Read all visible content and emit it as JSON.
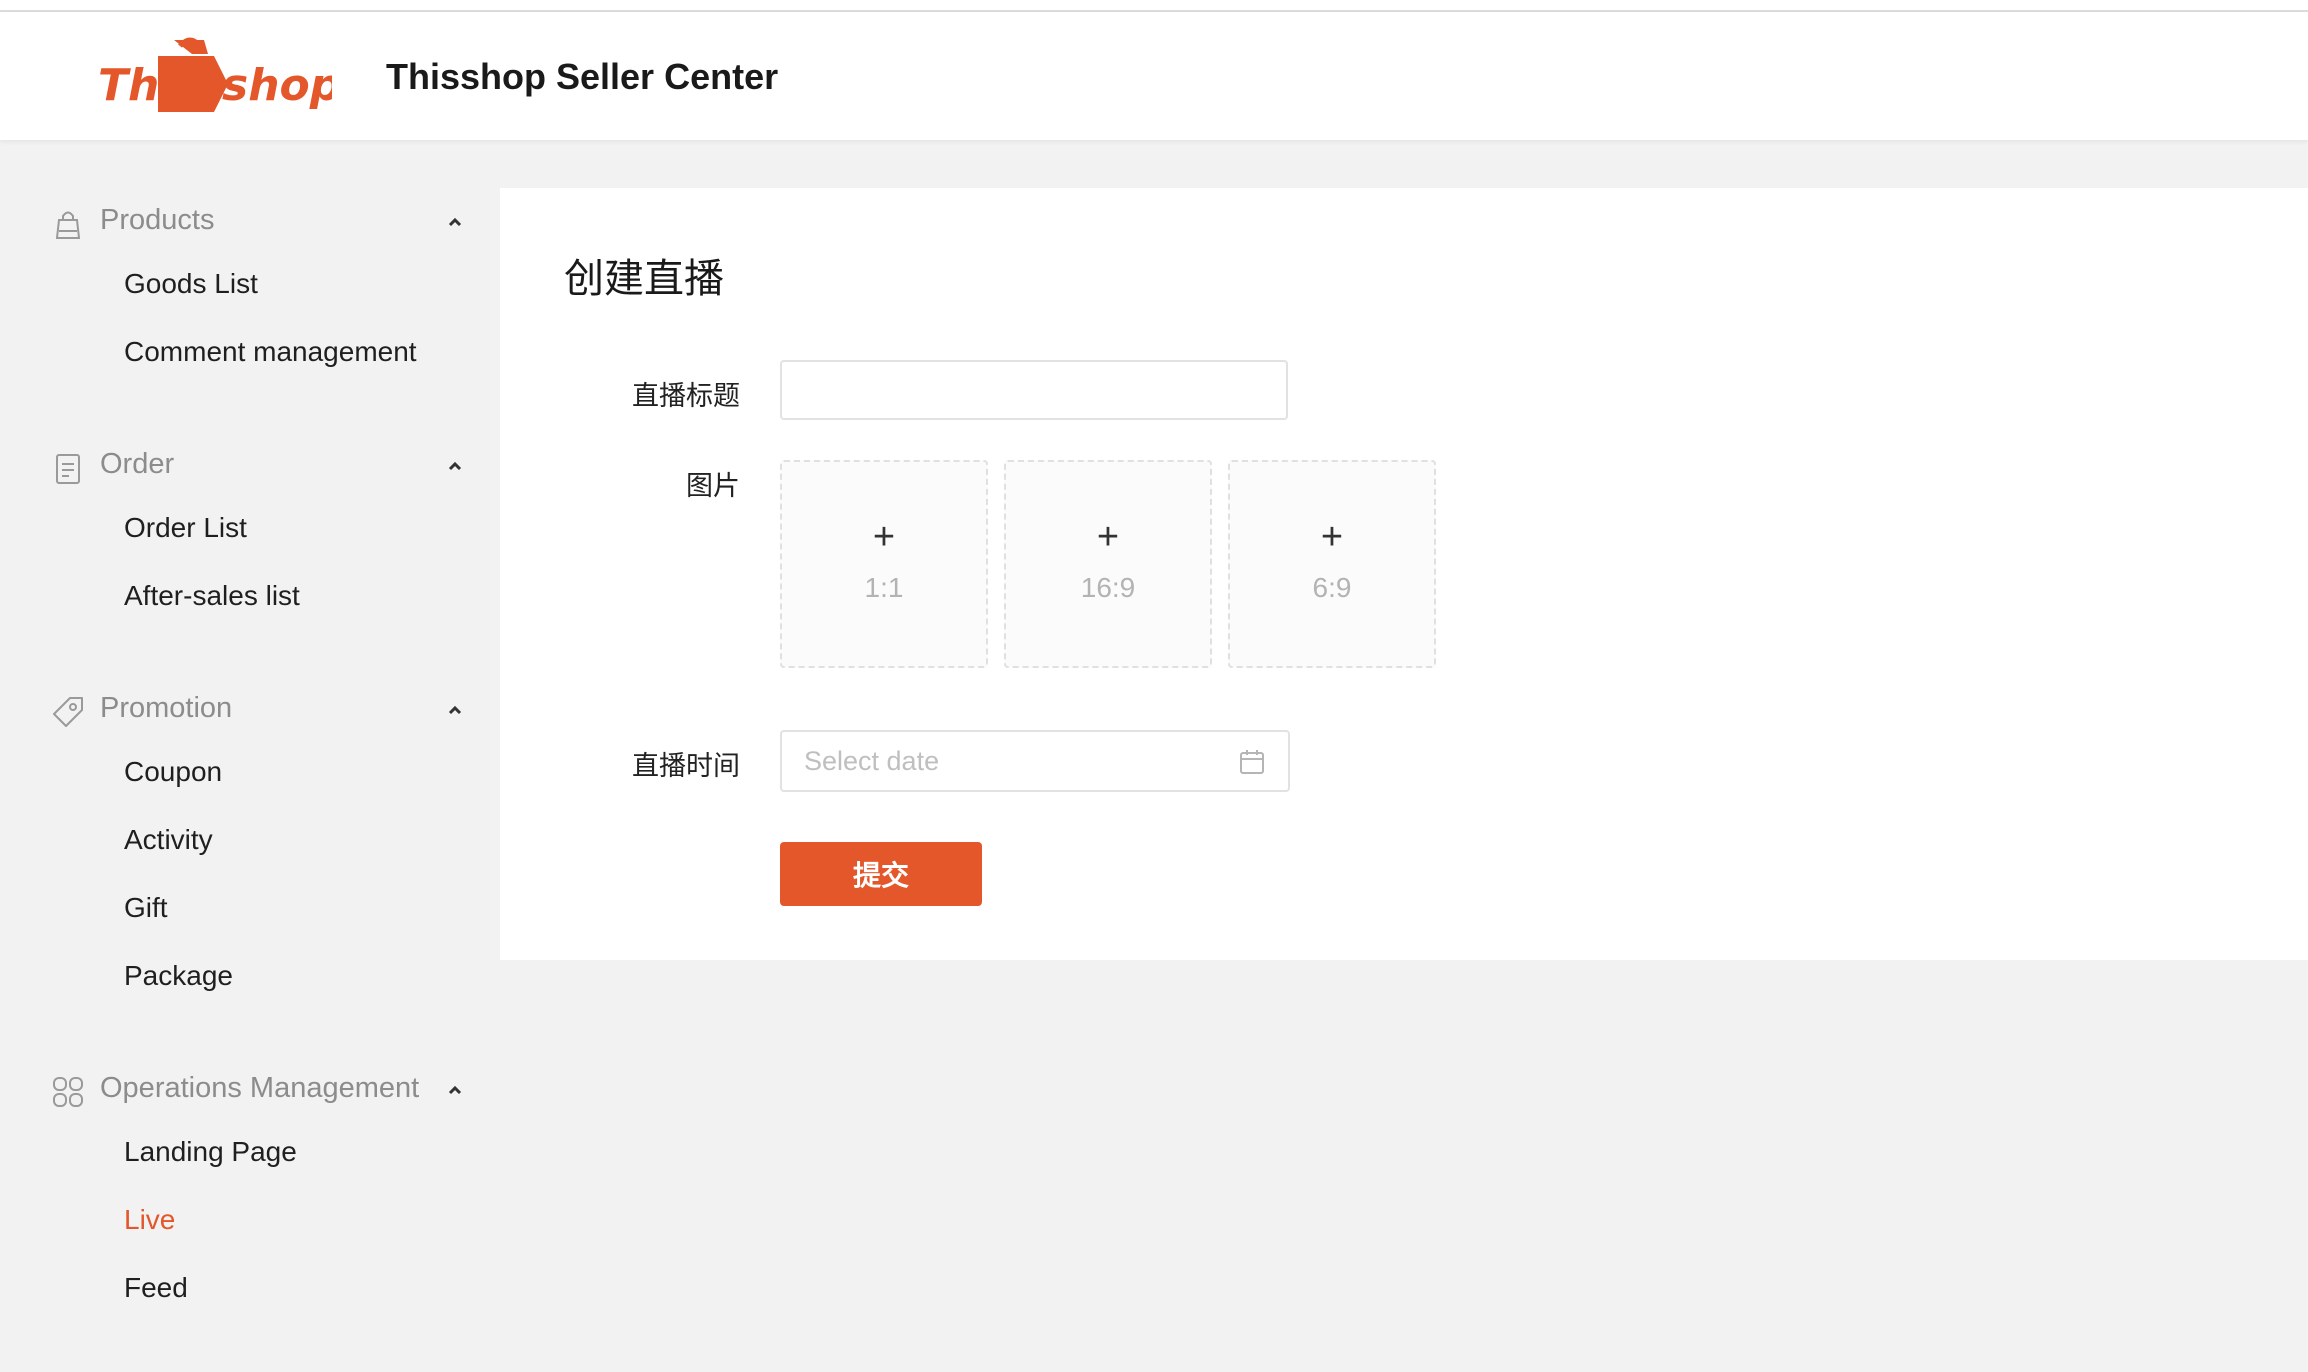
{
  "header": {
    "logo_text_left": "This",
    "logo_text_right": "shop",
    "title": "Thisshop Seller Center"
  },
  "sidebar": {
    "groups": [
      {
        "label": "Products",
        "icon": "bag-icon",
        "expanded": true,
        "items": [
          {
            "label": "Goods List"
          },
          {
            "label": "Comment management"
          }
        ]
      },
      {
        "label": "Order",
        "icon": "clipboard-icon",
        "expanded": true,
        "items": [
          {
            "label": "Order List"
          },
          {
            "label": "After-sales list"
          }
        ]
      },
      {
        "label": "Promotion",
        "icon": "tag-icon",
        "expanded": true,
        "items": [
          {
            "label": "Coupon"
          },
          {
            "label": "Activity"
          },
          {
            "label": "Gift"
          },
          {
            "label": "Package"
          }
        ]
      },
      {
        "label": "Operations Management",
        "icon": "command-icon",
        "expanded": true,
        "items": [
          {
            "label": "Landing Page"
          },
          {
            "label": "Live",
            "active": true
          },
          {
            "label": "Feed"
          }
        ]
      }
    ]
  },
  "main": {
    "title": "创建直播",
    "form": {
      "title_label": "直播标题",
      "title_value": "",
      "image_label": "图片",
      "uploads": [
        {
          "ratio": "1:1"
        },
        {
          "ratio": "16:9"
        },
        {
          "ratio": "6:9"
        }
      ],
      "upload_plus": "+",
      "time_label": "直播时间",
      "date_placeholder": "Select date",
      "submit_label": "提交"
    }
  },
  "colors": {
    "accent": "#e4572a",
    "background": "#f2f2f2",
    "panel": "#ffffff",
    "muted_text": "#8c8c8c",
    "placeholder": "#bfbfbf"
  }
}
